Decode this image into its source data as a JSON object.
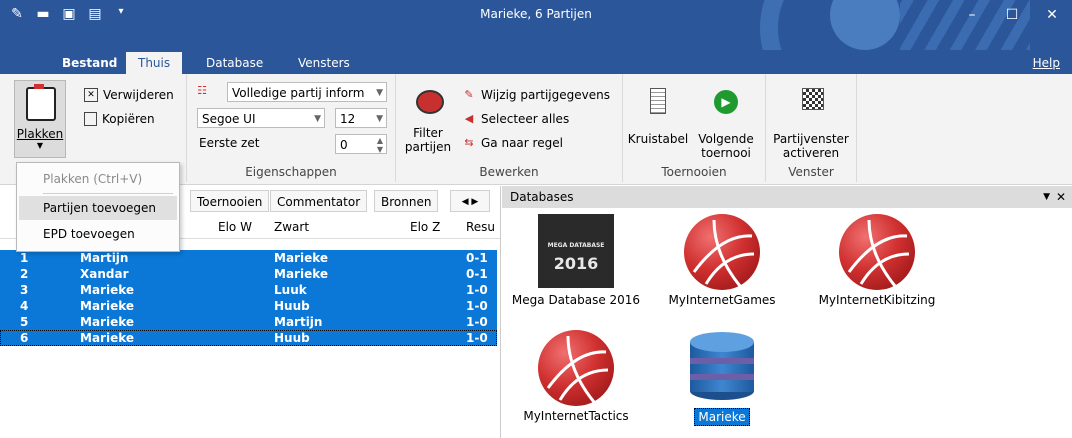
{
  "titlebar": {
    "title": "Marieke,  6 Partijen",
    "qat_icons": [
      "edit-icon",
      "folder-open-icon",
      "print-icon",
      "save-all-icon",
      "qat-menu-icon"
    ],
    "controls": {
      "minimize": "–",
      "maximize": "☐",
      "close": "✕"
    }
  },
  "tabs": {
    "file": "Bestand",
    "home": "Thuis",
    "database": "Database",
    "windows": "Vensters",
    "help": "Help"
  },
  "ribbon": {
    "clipboard": {
      "paste": "Plakken",
      "delete": "Verwijderen",
      "copy": "Kopiëren"
    },
    "properties": {
      "view_combo": "Volledige partij inform",
      "font_combo": "Segoe UI",
      "size_combo": "12",
      "first_move_label": "Eerste zet",
      "first_move_value": "0",
      "group_label": "Eigenschappen"
    },
    "edit": {
      "filter": "Filter\npartijen",
      "change_game_data": "Wijzig partijgegevens",
      "select_all": "Selecteer alles",
      "goto_line": "Ga naar regel",
      "group_label": "Bewerken"
    },
    "tournaments": {
      "crosstable": "Kruistabel",
      "next_tournament": "Volgende\ntoernooi",
      "group_label": "Toernooien"
    },
    "window": {
      "activate": "Partijvenster\nactiveren",
      "group_label": "Venster"
    }
  },
  "paste_menu": {
    "items": [
      {
        "label": "Plakken (Ctrl+V)",
        "enabled": false
      },
      {
        "label": "Partijen toevoegen",
        "enabled": true
      },
      {
        "label": "EPD toevoegen",
        "enabled": true
      }
    ]
  },
  "games_pane": {
    "tabs": [
      "Toernooien",
      "Commentator",
      "Bronnen"
    ],
    "columns": {
      "elo_w": "Elo W",
      "black": "Zwart",
      "elo_b": "Elo Z",
      "result": "Resu"
    },
    "rows": [
      {
        "n": "1",
        "white": "Martijn",
        "black": "Marieke",
        "result": "0-1"
      },
      {
        "n": "2",
        "white": "Xandar",
        "black": "Marieke",
        "result": "0-1"
      },
      {
        "n": "3",
        "white": "Marieke",
        "black": "Luuk",
        "result": "1-0"
      },
      {
        "n": "4",
        "white": "Marieke",
        "black": "Huub",
        "result": "1-0"
      },
      {
        "n": "5",
        "white": "Marieke",
        "black": "Martijn",
        "result": "1-0"
      },
      {
        "n": "6",
        "white": "Marieke",
        "black": "Huub",
        "result": "1-0"
      }
    ]
  },
  "databases": {
    "title": "Databases",
    "items": [
      {
        "label": "Mega Database 2016",
        "icon": "mega-database-icon",
        "cover_line1": "MEGA DATABASE",
        "cover_line2": "2016"
      },
      {
        "label": "MyInternetGames",
        "icon": "internet-ball-icon"
      },
      {
        "label": "MyInternetKibitzing",
        "icon": "internet-ball-icon"
      },
      {
        "label": "MyInternetTactics",
        "icon": "internet-ball-icon"
      },
      {
        "label": "Marieke",
        "icon": "database-cylinder-icon",
        "selected": true
      }
    ]
  },
  "colors": {
    "accent": "#2b579a",
    "selection": "#0b78d7",
    "ribbon_bg": "#f3f3f3"
  }
}
